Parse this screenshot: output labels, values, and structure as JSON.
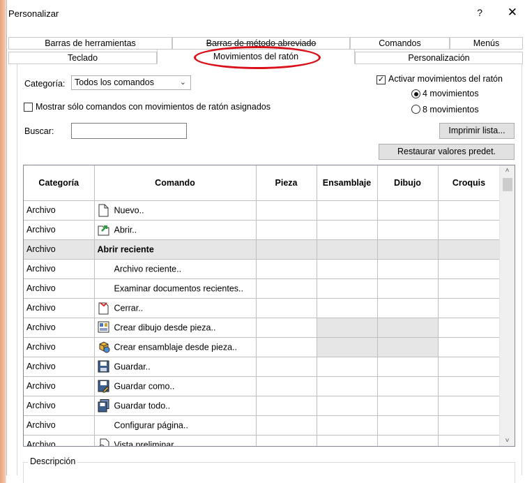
{
  "window": {
    "title": "Personalizar",
    "help_glyph": "?",
    "close_glyph": "✕"
  },
  "tabs": {
    "row1": [
      "Barras de herramientas",
      "Barras de método abreviado",
      "Comandos",
      "Menús"
    ],
    "row2": [
      "Teclado",
      "Movimientos del ratón",
      "Personalización"
    ],
    "active": "Movimientos del ratón"
  },
  "accent_colors": {
    "annotation": "#d9101a",
    "grey_row": "#e6e6e6"
  },
  "controls": {
    "category_label": "Categoría:",
    "category_value": "Todos los comandos",
    "show_only_label": "Mostrar sólo comandos con movimientos de ratón asignados",
    "show_only_checked": false,
    "search_label": "Buscar:",
    "search_value": "",
    "enable_gestures_label": "Activar movimientos del ratón",
    "enable_gestures_checked": true,
    "radio_4_label": "4 movimientos",
    "radio_8_label": "8 movimientos",
    "selected_radio": "4 movimientos",
    "print_button": "Imprimir lista...",
    "restore_button": "Restaurar valores predet."
  },
  "table": {
    "headers": [
      "Categoría",
      "Comando",
      "Pieza",
      "Ensamblaje",
      "Dibujo",
      "Croquis"
    ],
    "rows": [
      {
        "cat": "Archivo",
        "cmd": "Nuevo..",
        "icon": "new-document-icon"
      },
      {
        "cat": "Archivo",
        "cmd": "Abrir..",
        "icon": "open-document-icon"
      },
      {
        "cat": "Archivo",
        "cmd": "Abrir reciente",
        "icon": "",
        "bold": true,
        "grey": true
      },
      {
        "cat": "Archivo",
        "cmd": "Archivo reciente..",
        "icon": ""
      },
      {
        "cat": "Archivo",
        "cmd": "Examinar documentos recientes..",
        "icon": ""
      },
      {
        "cat": "Archivo",
        "cmd": "Cerrar..",
        "icon": "close-document-icon"
      },
      {
        "cat": "Archivo",
        "cmd": "Crear dibujo desde pieza..",
        "icon": "make-drawing-icon",
        "shade": [
          2,
          3
        ]
      },
      {
        "cat": "Archivo",
        "cmd": "Crear ensamblaje desde pieza..",
        "icon": "make-assembly-icon",
        "shade": [
          2,
          3
        ]
      },
      {
        "cat": "Archivo",
        "cmd": "Guardar..",
        "icon": "save-icon"
      },
      {
        "cat": "Archivo",
        "cmd": "Guardar como..",
        "icon": "save-as-icon"
      },
      {
        "cat": "Archivo",
        "cmd": "Guardar todo..",
        "icon": "save-all-icon"
      },
      {
        "cat": "Archivo",
        "cmd": "Configurar página..",
        "icon": ""
      },
      {
        "cat": "Archivo",
        "cmd": "Vista preliminar..",
        "icon": "print-preview-icon"
      }
    ]
  },
  "scrollbar": {
    "up_glyph": "˄",
    "down_glyph": "˅"
  },
  "description": {
    "label": "Descripción"
  }
}
